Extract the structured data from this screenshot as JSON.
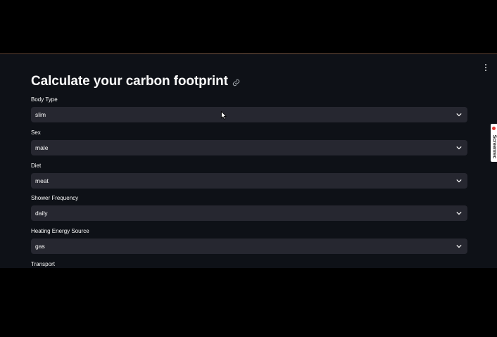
{
  "page": {
    "title": "Calculate your carbon footprint"
  },
  "fields": [
    {
      "label": "Body Type",
      "value": "slim"
    },
    {
      "label": "Sex",
      "value": "male"
    },
    {
      "label": "Diet",
      "value": "meat"
    },
    {
      "label": "Shower Frequency",
      "value": "daily"
    },
    {
      "label": "Heating Energy Source",
      "value": "gas"
    },
    {
      "label": "Transport",
      "value": ""
    }
  ],
  "overlay": {
    "recorder_label": "Screenrec"
  },
  "colors": {
    "background": "#0e1117",
    "select_bg": "#262730",
    "text": "#fafafa",
    "recorder_dot": "#e53935"
  },
  "icons": {
    "title_anchor": "link-icon",
    "select_arrow": "chevron-down-icon",
    "app_menu": "more-vertical-icon"
  }
}
